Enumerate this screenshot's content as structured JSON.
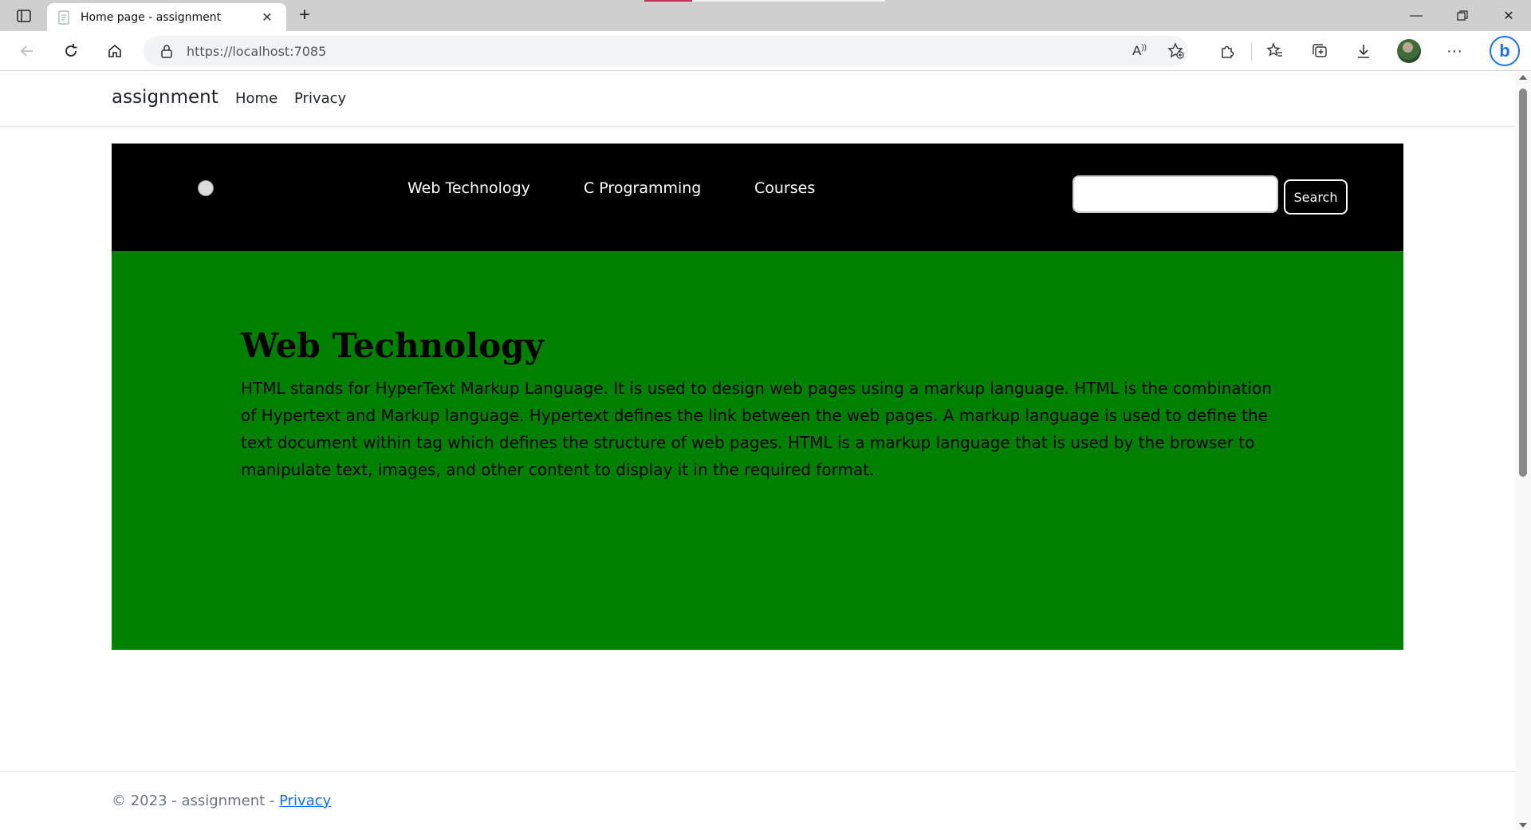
{
  "browser": {
    "tab_title": "Home page - assignment",
    "url": "https://localhost:7085"
  },
  "site": {
    "brand": "assignment",
    "nav": [
      "Home",
      "Privacy"
    ]
  },
  "panel": {
    "menu": [
      "Web Technology",
      "C Programming",
      "Courses"
    ],
    "search_value": "",
    "search_button": "Search",
    "heading": "Web Technology",
    "body": "HTML stands for HyperText Markup Language. It is used to design web pages using a markup language. HTML is the combination of Hypertext and Markup language. Hypertext defines the link between the web pages. A markup language is used to define the text document within tag which defines the structure of web pages. HTML is a markup language that is used by the browser to manipulate text, images, and other content to display it in the required format.",
    "colors": {
      "nav_bg": "#000000",
      "content_bg": "#008000"
    }
  },
  "footer": {
    "text": "© 2023 - assignment - ",
    "link": "Privacy"
  }
}
